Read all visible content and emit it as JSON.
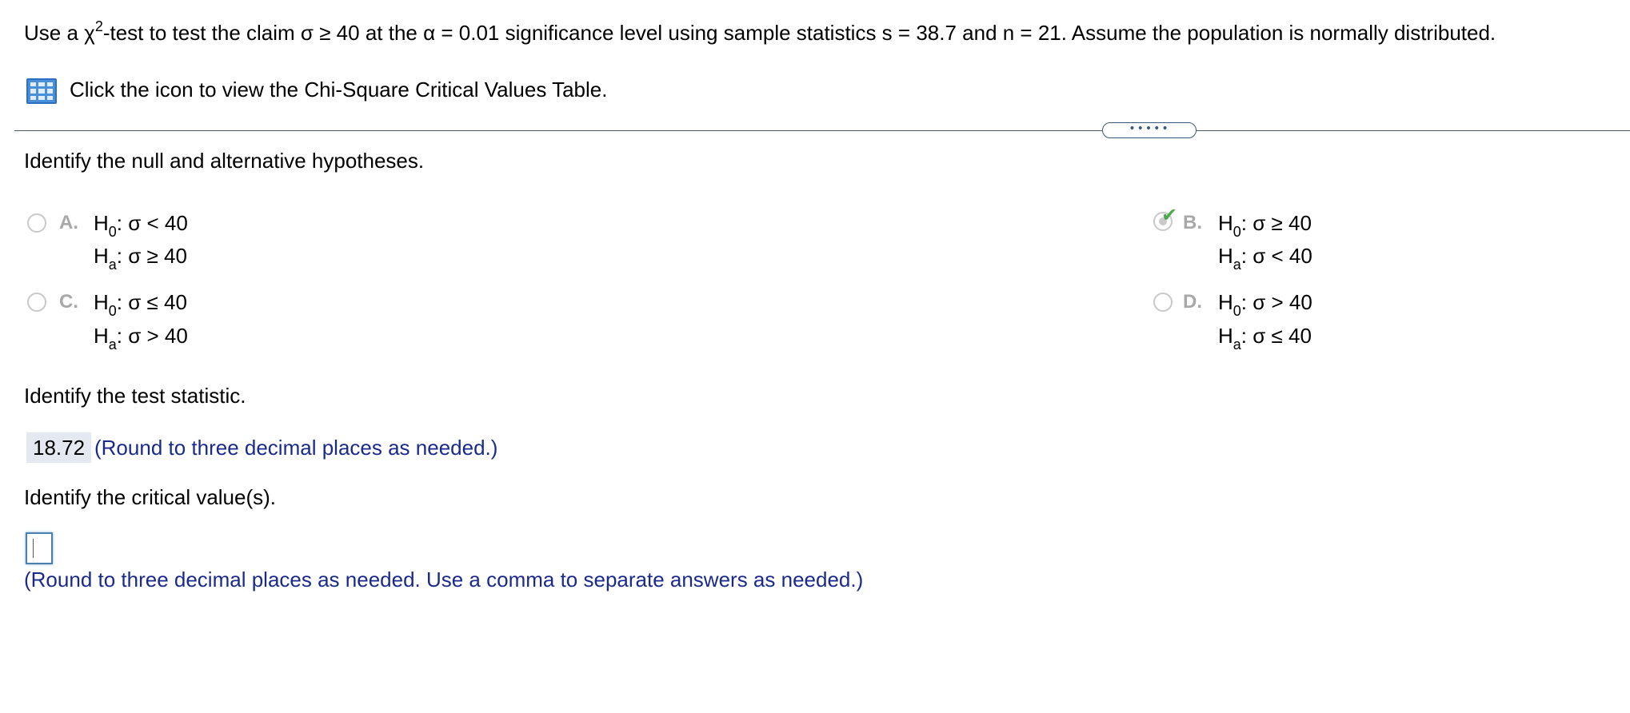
{
  "question": {
    "intro_prefix": "Use a ",
    "chi_symbol": "χ",
    "chi_exponent": "2",
    "intro_rest": "-test to test the claim σ ≥ 40 at the α = 0.01 significance level using sample statistics s = 38.7 and n = 21. Assume the population is normally distributed."
  },
  "table_link": {
    "icon": "table-icon",
    "text": "Click the icon to view the Chi-Square Critical Values Table."
  },
  "divider": {
    "handle_text": "•••••"
  },
  "part1": {
    "prompt": "Identify the null and alternative hypotheses.",
    "options": [
      {
        "letter": "A.",
        "h0_letter": "H",
        "h0_sub": "0",
        "h0_rel": ": σ < 40",
        "ha_letter": "H",
        "ha_sub": "a",
        "ha_rel": ": σ ≥ 40",
        "selected": false
      },
      {
        "letter": "B.",
        "h0_letter": "H",
        "h0_sub": "0",
        "h0_rel": ": σ ≥ 40",
        "ha_letter": "H",
        "ha_sub": "a",
        "ha_rel": ": σ < 40",
        "selected": true,
        "check_icon": "checkmark-icon"
      },
      {
        "letter": "C.",
        "h0_letter": "H",
        "h0_sub": "0",
        "h0_rel": ": σ ≤ 40",
        "ha_letter": "H",
        "ha_sub": "a",
        "ha_rel": ": σ > 40",
        "selected": false
      },
      {
        "letter": "D.",
        "h0_letter": "H",
        "h0_sub": "0",
        "h0_rel": ": σ > 40",
        "ha_letter": "H",
        "ha_sub": "a",
        "ha_rel": ": σ ≤ 40",
        "selected": false
      }
    ]
  },
  "part2": {
    "prompt": "Identify the test statistic.",
    "answer": "18.72",
    "hint": "(Round to three decimal places as needed.)"
  },
  "part3": {
    "prompt": "Identify the critical value(s).",
    "input_value": "",
    "hint": "(Round to three decimal places as needed. Use a comma to separate answers as needed.)"
  },
  "colors": {
    "hint_text": "#1a2a8c",
    "correct_check": "#4ca84c",
    "answer_box_bg": "#e4e8f0",
    "input_border": "#4b7fad"
  }
}
